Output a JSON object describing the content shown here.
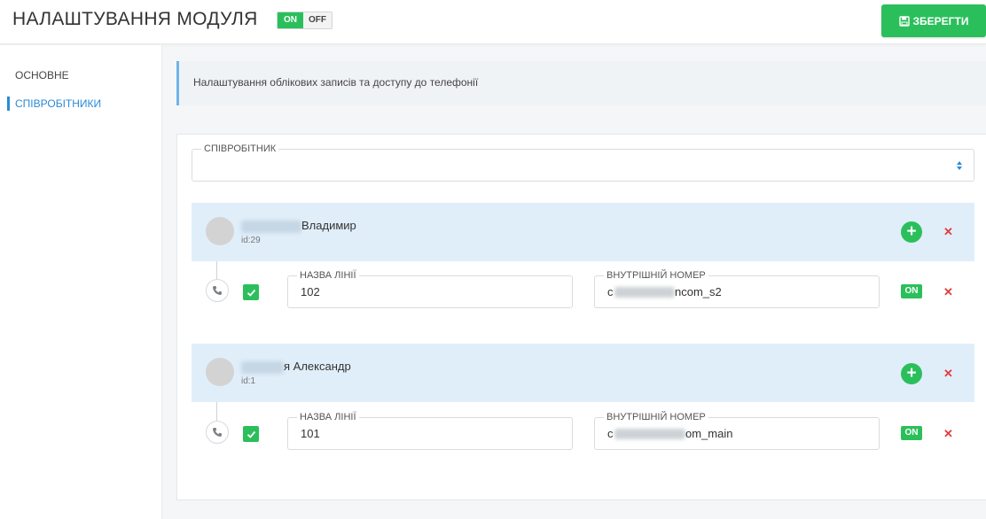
{
  "header": {
    "title": "НАЛАШТУВАННЯ МОДУЛЯ",
    "toggle_on": "ON",
    "toggle_off": "OFF",
    "save_label": "ЗБЕРЕГТИ",
    "save_icon": "floppy-disk-icon"
  },
  "sidebar": {
    "items": [
      {
        "label": "ОСНОВНЕ",
        "active": false
      },
      {
        "label": "СПІВРОБІТНИКИ",
        "active": true
      }
    ]
  },
  "info": {
    "text": "Налаштування облікових записів та доступу до телефонії"
  },
  "employee_select": {
    "label": "СПІВРОБІТНИК",
    "value": ""
  },
  "employees": [
    {
      "name_visible": "Владимир",
      "id": "id:29",
      "lines": [
        {
          "line_name_label": "НАЗВА ЛІНІЇ",
          "line_name": "102",
          "internal_label": "ВНУТРІШНІЙ НОМЕР",
          "internal_prefix": "c",
          "internal_suffix": "ncom_s2",
          "enabled": true,
          "status": "ON"
        }
      ]
    },
    {
      "name_visible": "я Александр",
      "id": "id:1",
      "lines": [
        {
          "line_name_label": "НАЗВА ЛІНІЇ",
          "line_name": "101",
          "internal_label": "ВНУТРІШНІЙ НОМЕР",
          "internal_prefix": "c",
          "internal_suffix": "om_main",
          "enabled": true,
          "status": "ON"
        }
      ]
    }
  ],
  "colors": {
    "accent_green": "#2bbf5c",
    "accent_blue": "#2a8ad6",
    "delete_red": "#e23b3b",
    "employee_header_bg": "#e0eefa"
  },
  "icons": {
    "add": "plus-circle-icon",
    "delete": "close-icon",
    "phone": "phone-icon",
    "check": "checkmark-icon",
    "select": "sort-arrows-icon"
  }
}
